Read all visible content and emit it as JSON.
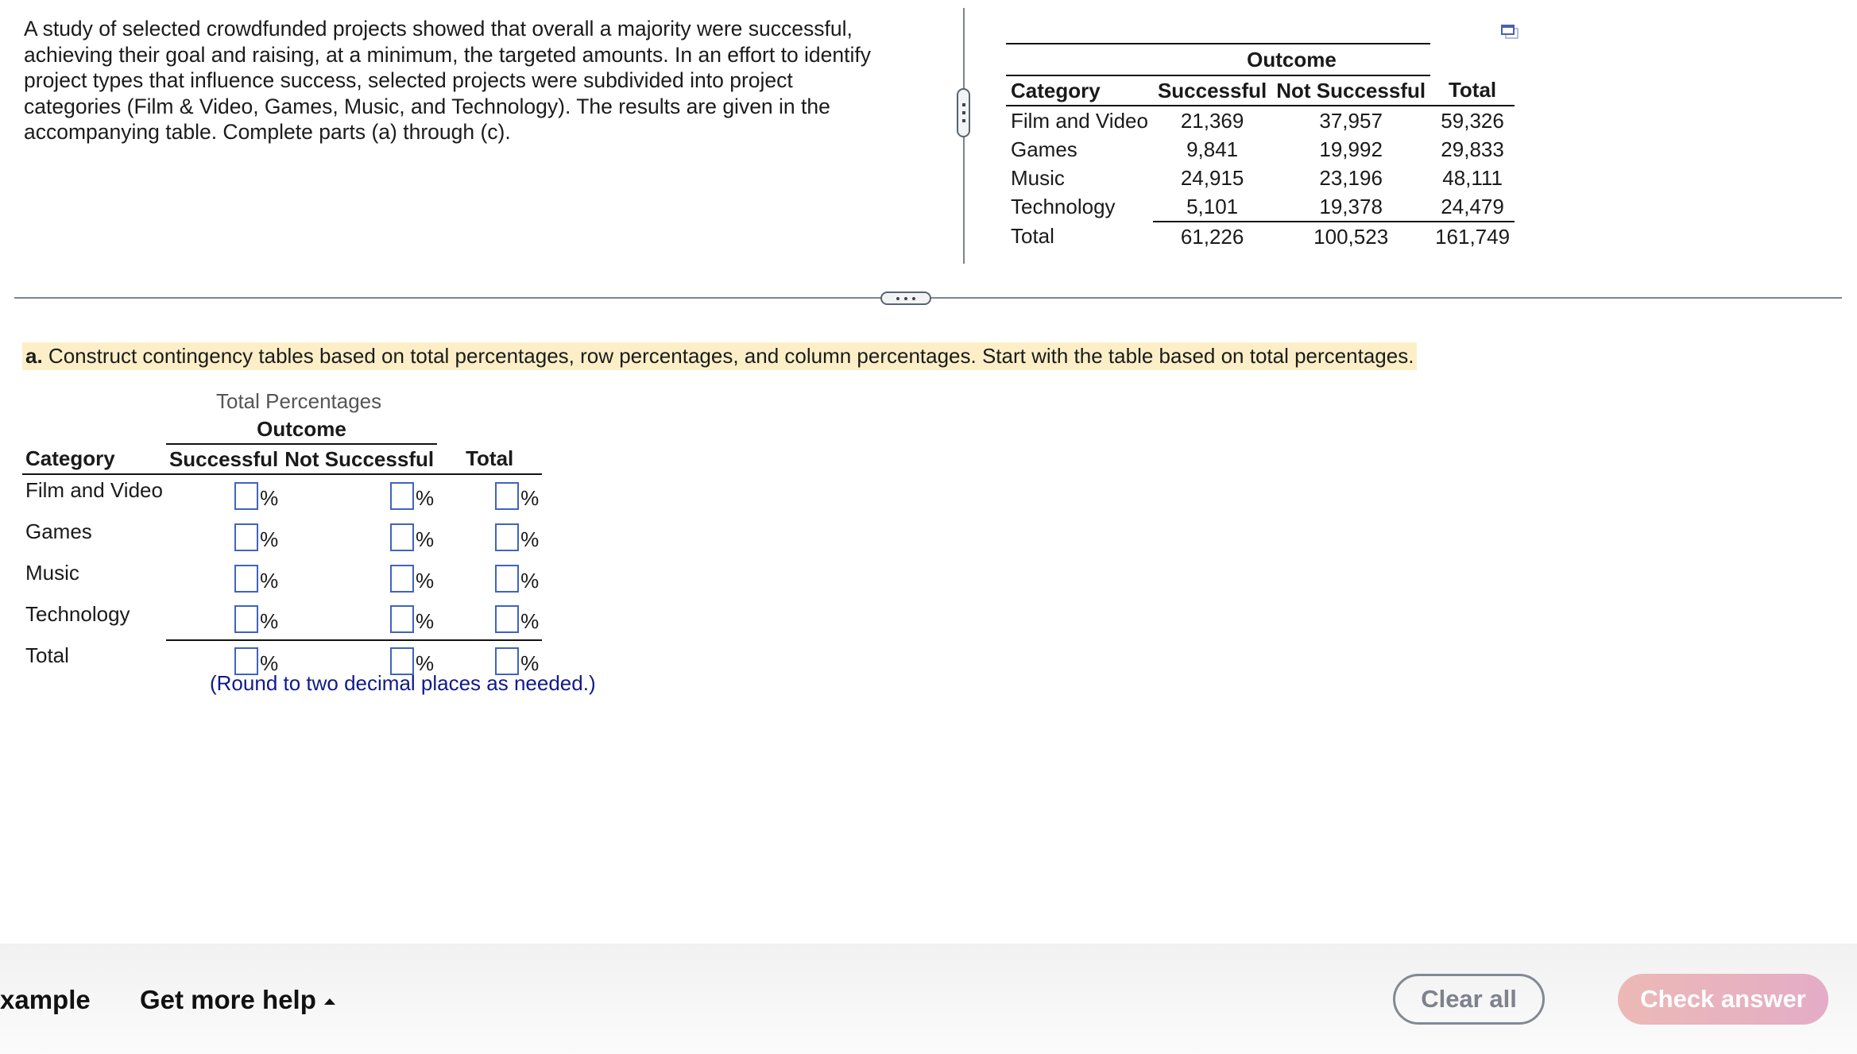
{
  "intro": {
    "text": "A study of selected crowdfunded projects showed that overall a majority were successful, achieving their goal and raising, at a minimum, the targeted amounts. In an effort to identify project types that influence success, selected projects were subdivided into project categories (Film & Video, Games, Music, and Technology). The results are given in the accompanying table. Complete parts (a) through (c)."
  },
  "data_table": {
    "group_header": "Outcome",
    "headers": [
      "Category",
      "Successful",
      "Not Successful",
      "Total"
    ],
    "rows": [
      {
        "category": "Film and Video",
        "successful": "21,369",
        "not_successful": "37,957",
        "total": "59,326"
      },
      {
        "category": "Games",
        "successful": "9,841",
        "not_successful": "19,992",
        "total": "29,833"
      },
      {
        "category": "Music",
        "successful": "24,915",
        "not_successful": "23,196",
        "total": "48,111"
      },
      {
        "category": "Technology",
        "successful": "5,101",
        "not_successful": "19,378",
        "total": "24,479"
      },
      {
        "category": "Total",
        "successful": "61,226",
        "not_successful": "100,523",
        "total": "161,749"
      }
    ]
  },
  "icons": {
    "popout": "popout-window-icon",
    "vertical_handle": "vertical-drag-handle",
    "horizontal_handle": "horizontal-drag-handle"
  },
  "part_a": {
    "label": "a.",
    "text": " Construct contingency tables based on total percentages, row percentages, and column percentages. Start with the table based on total percentages."
  },
  "answer_table": {
    "title": "Total Percentages",
    "group_header": "Outcome",
    "headers": [
      "Category",
      "Successful",
      "Not Successful",
      "Total"
    ],
    "rows": [
      "Film and Video",
      "Games",
      "Music",
      "Technology",
      "Total"
    ],
    "unit": "%",
    "values": [
      [
        "",
        "",
        ""
      ],
      [
        "",
        "",
        ""
      ],
      [
        "",
        "",
        ""
      ],
      [
        "",
        "",
        ""
      ],
      [
        "",
        "",
        ""
      ]
    ],
    "note": "(Round to two decimal places as needed.)"
  },
  "footer": {
    "example_label": "xample",
    "help_label": "Get more help",
    "clear_label": "Clear all",
    "check_label": "Check answer"
  },
  "colors": {
    "input_border": "#3f63c0",
    "note_text": "#101a8c",
    "highlight": "#fcefc7",
    "check_button": "#e8b3bf"
  }
}
